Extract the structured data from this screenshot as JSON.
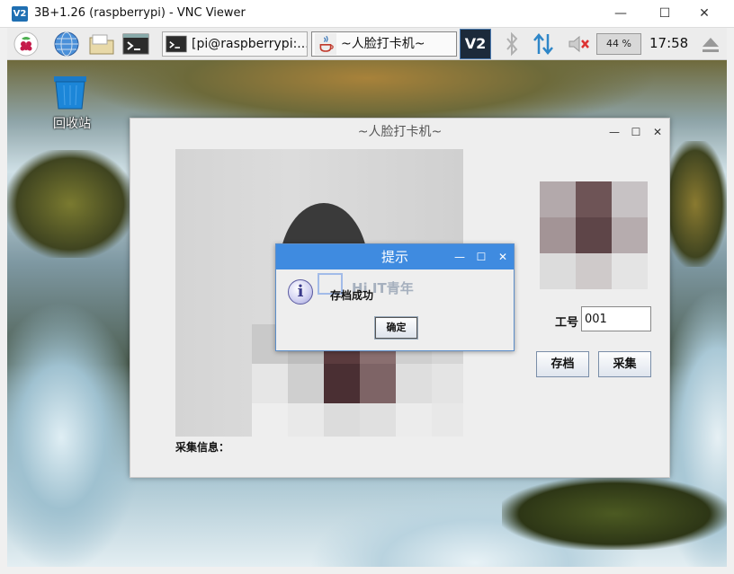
{
  "vnc": {
    "logo": "V2",
    "title": "3B+1.26 (raspberrypi) - VNC Viewer",
    "minimize": "—",
    "maximize": "☐",
    "close": "✕"
  },
  "taskbar": {
    "tasks": [
      {
        "label": "[pi@raspberrypi:..."
      },
      {
        "label": "~人脸打卡机~"
      }
    ],
    "vnc_logo": "V2",
    "volume": "44 %",
    "clock": "17:58",
    "icons": [
      "raspberry-icon",
      "globe-icon",
      "folder-icon",
      "terminal-icon",
      "terminal-icon",
      "java-icon",
      "vnc-icon",
      "bluetooth-icon",
      "network-arrows-icon",
      "mute-icon",
      "eject-icon"
    ]
  },
  "desktop": {
    "trash_label": "回收站"
  },
  "app": {
    "title": "~人脸打卡机~",
    "collect_label": "采集信息：",
    "id_label": "工号",
    "id_value": "001",
    "save_button": "存档",
    "collect_button": "采集"
  },
  "dialog": {
    "title": "提示",
    "icon": "i",
    "message": "存档成功",
    "ok_button": "确定",
    "watermark": "Hi IT青年"
  },
  "colors": {
    "dialog_title_bg": "#3f8be0",
    "vnc_logo_bg": "#1f6fb2"
  }
}
